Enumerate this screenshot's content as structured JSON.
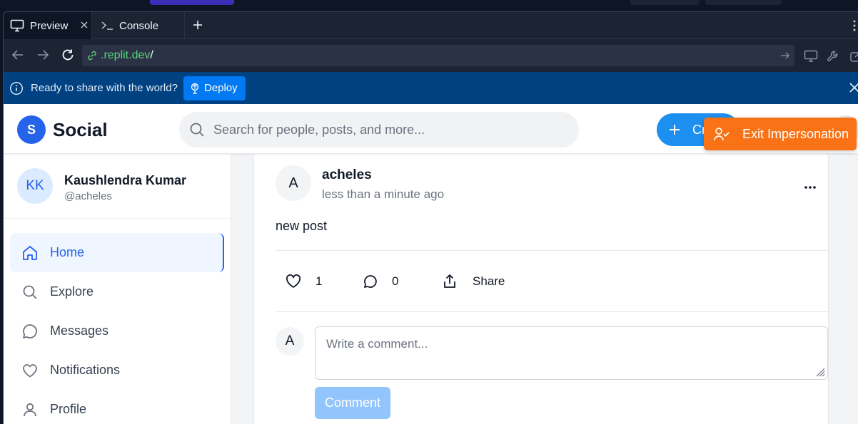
{
  "browser": {
    "tabs": [
      {
        "label": "Preview",
        "icon": "monitor-icon"
      },
      {
        "label": "Console",
        "icon": "terminal-icon"
      }
    ],
    "url": {
      "host": ".replit.dev",
      "path": "/"
    }
  },
  "banner": {
    "message": "Ready to share with the world?",
    "deploy_label": "Deploy"
  },
  "app": {
    "logo_letter": "S",
    "brand": "Social",
    "search_placeholder": "Search for people, posts, and more...",
    "create_label": "Create",
    "exit_impersonation_label": "Exit Impersonation"
  },
  "user": {
    "initials": "KK",
    "name": "Kaushlendra Kumar",
    "handle": "@acheles"
  },
  "nav": [
    {
      "label": "Home",
      "icon": "home-icon",
      "active": true
    },
    {
      "label": "Explore",
      "icon": "search-icon",
      "active": false
    },
    {
      "label": "Messages",
      "icon": "message-icon",
      "active": false
    },
    {
      "label": "Notifications",
      "icon": "heart-icon",
      "active": false
    },
    {
      "label": "Profile",
      "icon": "user-icon",
      "active": false
    }
  ],
  "post": {
    "avatar_letter": "A",
    "author": "acheles",
    "time": "less than a minute ago",
    "body": "new post",
    "likes": "1",
    "comments": "0",
    "share_label": "Share"
  },
  "comment_box": {
    "avatar_letter": "A",
    "placeholder": "Write a comment...",
    "button_label": "Comment"
  },
  "colors": {
    "accent": "#2563eb",
    "exit_button": "#f97316",
    "banner": "#004182",
    "deploy_button": "#0079f2"
  }
}
